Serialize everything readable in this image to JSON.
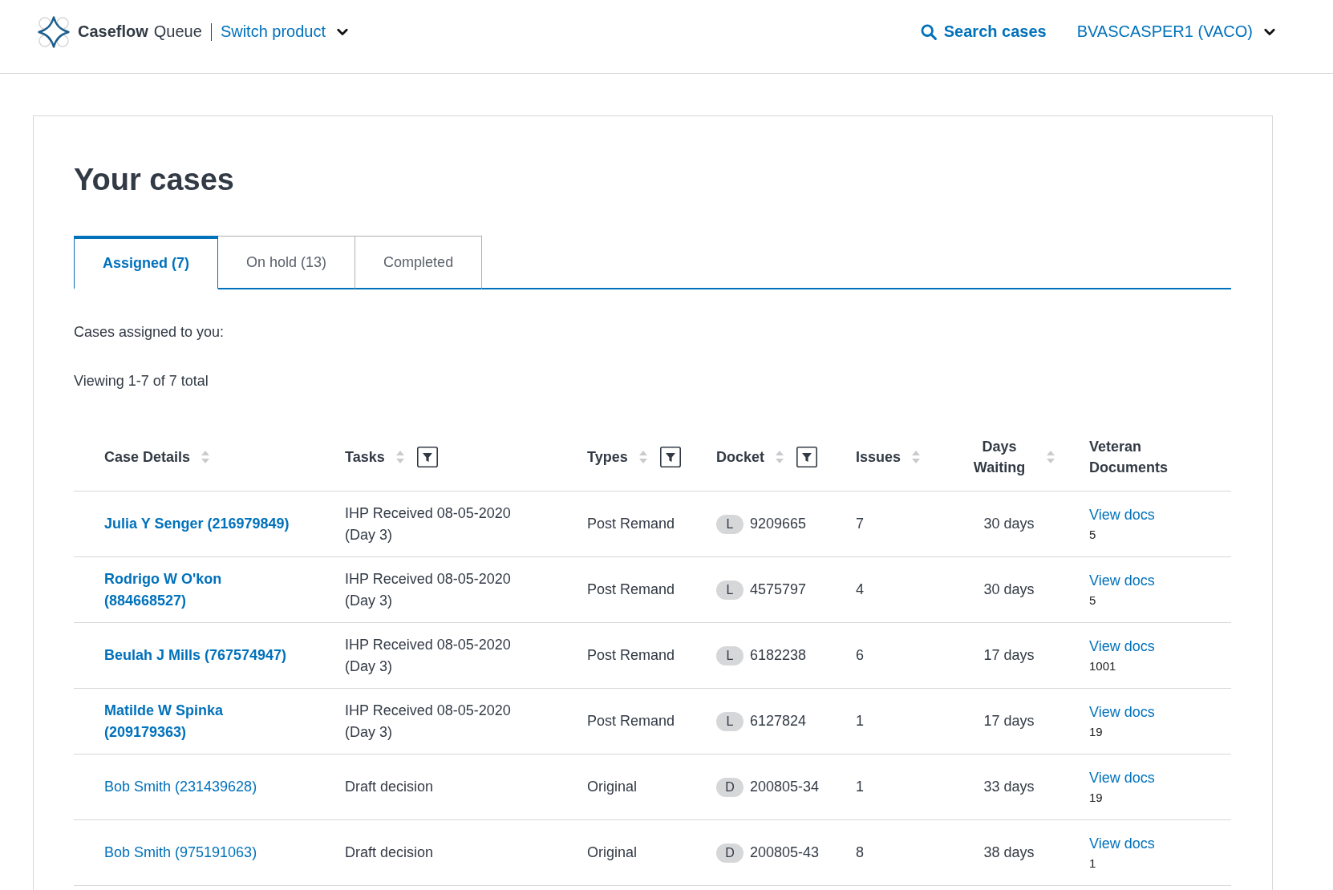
{
  "header": {
    "app_name": "Caseflow",
    "app_section": "Queue",
    "switch_product": "Switch product",
    "search": "Search cases",
    "user": "BVASCASPER1 (VACO)"
  },
  "title": "Your cases",
  "tabs": [
    {
      "label": "Assigned (7)",
      "selected": true
    },
    {
      "label": "On hold (13)",
      "selected": false
    },
    {
      "label": "Completed",
      "selected": false
    }
  ],
  "intro": "Cases assigned to you:",
  "viewing": "Viewing 1-7 of 7 total",
  "table": {
    "columns": [
      {
        "label": "Case Details",
        "sortable": true,
        "filterable": false
      },
      {
        "label": "Tasks",
        "sortable": true,
        "filterable": true
      },
      {
        "label": "Types",
        "sortable": true,
        "filterable": true
      },
      {
        "label": "Docket",
        "sortable": true,
        "filterable": true
      },
      {
        "label": "Issues",
        "sortable": true,
        "filterable": false
      },
      {
        "label": "Days Waiting",
        "sortable": true,
        "filterable": false
      },
      {
        "label": "Veteran Documents",
        "sortable": false,
        "filterable": false
      }
    ],
    "rows": [
      {
        "case": "Julia Y Senger (216979849)",
        "viewed": false,
        "task": "IHP Received 08-05-2020 (Day 3)",
        "type": "Post Remand",
        "docket_type": "L",
        "docket_number": "9209665",
        "issues": "7",
        "days_waiting": "30 days",
        "docs_link": "View docs",
        "docs_count": "5"
      },
      {
        "case": "Rodrigo W O'kon (884668527)",
        "viewed": false,
        "task": "IHP Received 08-05-2020 (Day 3)",
        "type": "Post Remand",
        "docket_type": "L",
        "docket_number": "4575797",
        "issues": "4",
        "days_waiting": "30 days",
        "docs_link": "View docs",
        "docs_count": "5"
      },
      {
        "case": "Beulah J Mills (767574947)",
        "viewed": false,
        "task": "IHP Received 08-05-2020 (Day 3)",
        "type": "Post Remand",
        "docket_type": "L",
        "docket_number": "6182238",
        "issues": "6",
        "days_waiting": "17 days",
        "docs_link": "View docs",
        "docs_count": "1001"
      },
      {
        "case": "Matilde W Spinka (209179363)",
        "viewed": false,
        "task": "IHP Received 08-05-2020 (Day 3)",
        "type": "Post Remand",
        "docket_type": "L",
        "docket_number": "6127824",
        "issues": "1",
        "days_waiting": "17 days",
        "docs_link": "View docs",
        "docs_count": "19"
      },
      {
        "case": "Bob Smith (231439628)",
        "viewed": true,
        "task": "Draft decision",
        "type": "Original",
        "docket_type": "D",
        "docket_number": "200805-34",
        "issues": "1",
        "days_waiting": "33 days",
        "docs_link": "View docs",
        "docs_count": "19"
      },
      {
        "case": "Bob Smith (975191063)",
        "viewed": true,
        "task": "Draft decision",
        "type": "Original",
        "docket_type": "D",
        "docket_number": "200805-43",
        "issues": "8",
        "days_waiting": "38 days",
        "docs_link": "View docs",
        "docs_count": "1"
      }
    ]
  }
}
